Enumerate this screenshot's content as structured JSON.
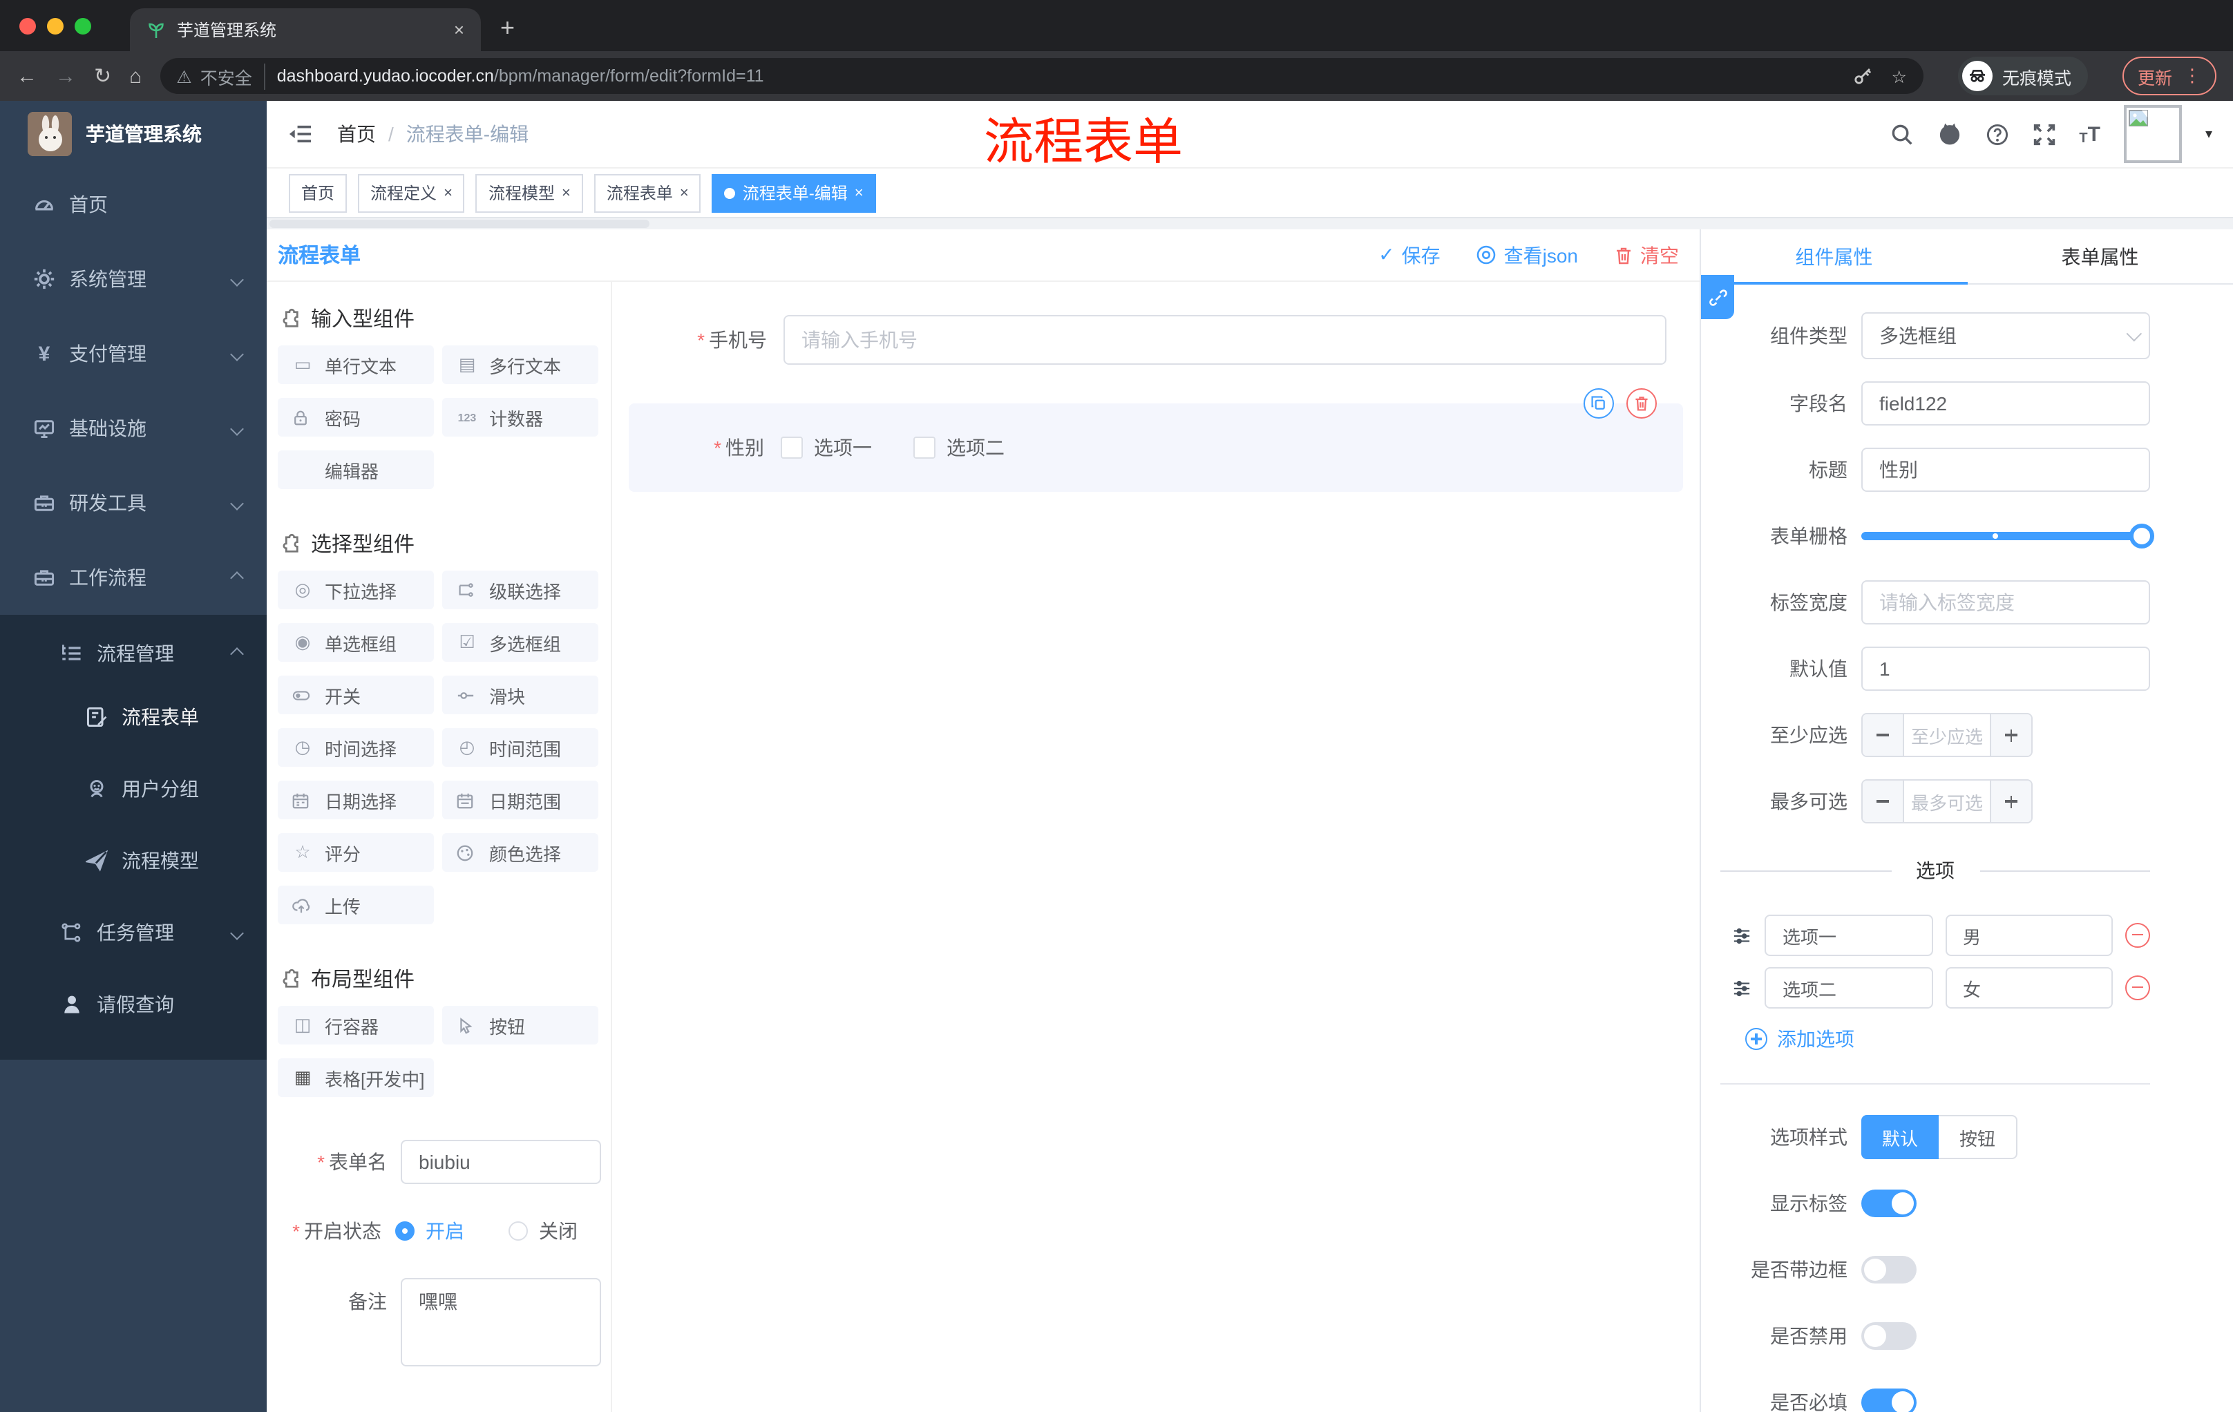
{
  "colors": {
    "accent": "#409EFF",
    "danger": "#F56C6C",
    "sidebar_bg": "#304156",
    "submenu_bg": "#1f2d3d",
    "annotation_red": "#FF1E00",
    "chrome_dark": "#202124",
    "chrome_bar": "#35363a",
    "update_red": "#f28b82",
    "selected_item_bg": "#f4f6fd",
    "tag_text": "#495060"
  },
  "icons": {
    "close": "×",
    "plus": "+",
    "back": "←",
    "forward": "→",
    "reload": "↻",
    "home": "⌂",
    "dots": "⋮",
    "caret_down": "▾",
    "star": "☆",
    "warning": "⚠",
    "check": "✓",
    "asterisk": "*",
    "yen": "¥",
    "font_t": "T",
    "slash": "/",
    "single_text": "▭",
    "multi_text": "▤",
    "counter": "123",
    "select": "◎",
    "radio": "◉",
    "checkbox": "☑",
    "time": "◷",
    "time_range": "◴",
    "rate": "☆",
    "row_container": "◫",
    "table": "▦"
  },
  "browser": {
    "tab_title": "芋道管理系统",
    "security": "不安全",
    "url_host": "dashboard.yudao.iocoder.cn",
    "url_path": "/bpm/manager/form/edit?formId=11",
    "incognito": "无痕模式",
    "update": "更新"
  },
  "sidebar": {
    "logo_title": "芋道管理系统",
    "items": [
      {
        "label": "首页"
      },
      {
        "label": "系统管理"
      },
      {
        "label": "支付管理"
      },
      {
        "label": "基础设施"
      },
      {
        "label": "研发工具"
      },
      {
        "label": "工作流程"
      }
    ],
    "process_mgmt": {
      "label": "流程管理"
    },
    "process_children": [
      {
        "label": "流程表单"
      },
      {
        "label": "用户分组"
      },
      {
        "label": "流程模型"
      }
    ],
    "task_mgmt": {
      "label": "任务管理"
    },
    "leave_query": {
      "label": "请假查询"
    }
  },
  "header": {
    "breadcrumb_home": "首页",
    "breadcrumb_current": "流程表单-编辑",
    "annotation": "流程表单"
  },
  "tags": [
    {
      "label": "首页"
    },
    {
      "label": "流程定义"
    },
    {
      "label": "流程模型"
    },
    {
      "label": "流程表单"
    },
    {
      "label": "流程表单-编辑"
    }
  ],
  "toolbar": {
    "title": "流程表单",
    "save": "保存",
    "view_json": "查看json",
    "clear": "清空"
  },
  "palette": {
    "sections": [
      {
        "title": "输入型组件"
      },
      {
        "title": "选择型组件"
      },
      {
        "title": "布局型组件"
      }
    ],
    "input_items": [
      {
        "label": "单行文本"
      },
      {
        "label": "多行文本"
      },
      {
        "label": "密码"
      },
      {
        "label": "计数器"
      },
      {
        "label": "编辑器"
      }
    ],
    "select_items": [
      {
        "label": "下拉选择"
      },
      {
        "label": "级联选择"
      },
      {
        "label": "单选框组"
      },
      {
        "label": "多选框组"
      },
      {
        "label": "开关"
      },
      {
        "label": "滑块"
      },
      {
        "label": "时间选择"
      },
      {
        "label": "时间范围"
      },
      {
        "label": "日期选择"
      },
      {
        "label": "日期范围"
      },
      {
        "label": "评分"
      },
      {
        "label": "颜色选择"
      },
      {
        "label": "上传"
      }
    ],
    "layout_items": [
      {
        "label": "行容器"
      },
      {
        "label": "按钮"
      },
      {
        "label": "表格[开发中]"
      }
    ]
  },
  "meta_form": {
    "name_label": "表单名",
    "name_value": "biubiu",
    "status_label": "开启状态",
    "status_on": "开启",
    "status_off": "关闭",
    "remark_label": "备注",
    "remark_value": "嘿嘿"
  },
  "canvas": {
    "phone_label": "手机号",
    "phone_placeholder": "请输入手机号",
    "gender_label": "性别",
    "gender_option1": "选项一",
    "gender_option2": "选项二"
  },
  "props": {
    "tab_component": "组件属性",
    "tab_form": "表单属性",
    "component_type_label": "组件类型",
    "component_type_value": "多选框组",
    "field_name_label": "字段名",
    "field_name_value": "field122",
    "title_label": "标题",
    "title_value": "性别",
    "grid_label": "表单栅格",
    "label_width_label": "标签宽度",
    "label_width_placeholder": "请输入标签宽度",
    "default_label": "默认值",
    "default_value": "1",
    "min_label": "至少应选",
    "min_placeholder": "至少应选",
    "max_label": "最多可选",
    "max_placeholder": "最多可选",
    "options_title": "选项",
    "options": [
      {
        "label": "选项一",
        "value": "男"
      },
      {
        "label": "选项二",
        "value": "女"
      }
    ],
    "add_option": "添加选项",
    "style_label": "选项样式",
    "style_default": "默认",
    "style_button": "按钮",
    "toggles": [
      {
        "label": "显示标签"
      },
      {
        "label": "是否带边框"
      },
      {
        "label": "是否禁用"
      },
      {
        "label": "是否必填"
      }
    ]
  }
}
